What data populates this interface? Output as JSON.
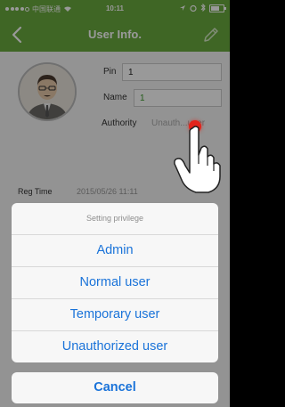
{
  "status_bar": {
    "carrier": "中国联通",
    "time": "10:11"
  },
  "nav": {
    "title": "User Info."
  },
  "profile": {
    "pin_label": "Pin",
    "pin_value": "1",
    "name_label": "Name",
    "name_value": "1",
    "authority_label": "Authority",
    "authority_value": "Unauth...user"
  },
  "registration": {
    "label": "Reg Time",
    "value": "2015/05/26 11:11"
  },
  "action_sheet": {
    "title": "Setting privilege",
    "options": [
      "Admin",
      "Normal user",
      "Temporary user",
      "Unauthorized user"
    ],
    "cancel_label": "Cancel"
  },
  "colors": {
    "nav_bar": "#6aab3f",
    "accent_blue": "#1a73d9",
    "tap_indicator": "#e2231a"
  },
  "icons": {
    "back": "chevron-left-icon",
    "edit": "pencil-icon",
    "avatar": "user-avatar-icon",
    "hand": "pointing-hand-icon"
  }
}
